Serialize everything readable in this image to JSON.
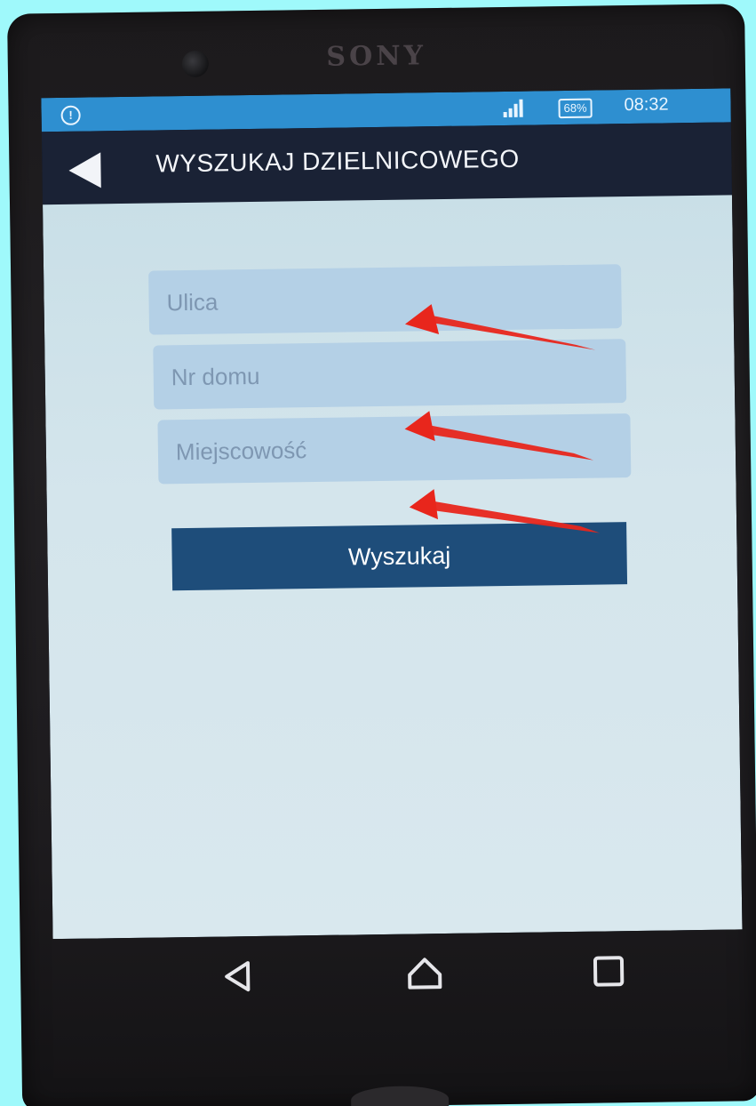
{
  "device": {
    "brand": "SONY"
  },
  "statusbar": {
    "warning_icon": "alert-circle-icon",
    "signal_icon": "signal-icon",
    "battery": "68%",
    "time": "08:32"
  },
  "appbar": {
    "back_icon": "back-arrow-icon",
    "title": "WYSZUKAJ DZIELNICOWEGO"
  },
  "form": {
    "street_placeholder": "Ulica",
    "house_number_placeholder": "Nr domu",
    "city_placeholder": "Miejscowość",
    "submit_label": "Wyszukaj"
  },
  "annotations": {
    "arrow_color": "#e8261c",
    "arrow_count": 3
  },
  "navbar": {
    "back_icon": "nav-back-icon",
    "home_icon": "nav-home-icon",
    "recent_icon": "nav-recent-apps-icon"
  },
  "colors": {
    "statusbar": "#2e8fd0",
    "appbar": "#1a2235",
    "button": "#1e4d7a",
    "field": "#b4d0e6",
    "background": "#9ff9fb"
  }
}
